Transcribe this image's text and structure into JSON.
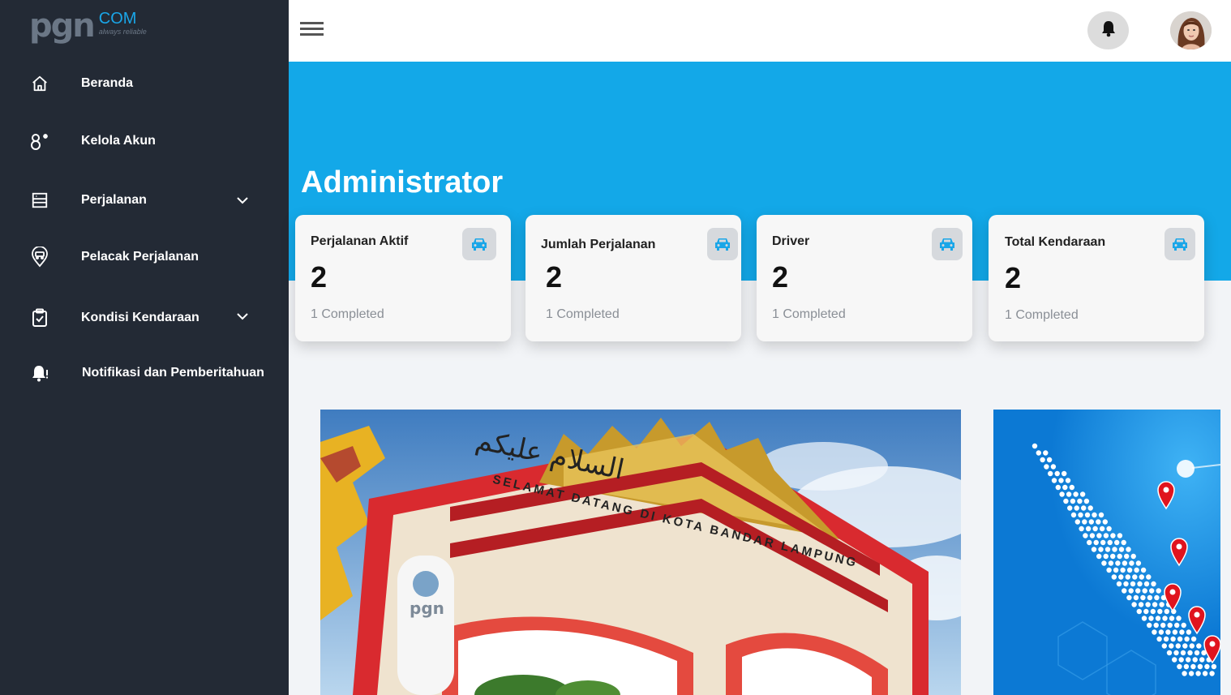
{
  "logo": {
    "brand": "pgn",
    "suffix": "COM",
    "tagline": "always reliable"
  },
  "sidebar": {
    "items": [
      {
        "label": "Beranda",
        "icon": "home-icon"
      },
      {
        "label": "Kelola Akun",
        "icon": "user-settings-icon"
      },
      {
        "label": "Perjalanan",
        "icon": "trip-list-icon",
        "expandable": true
      },
      {
        "label": "Pelacak Perjalanan",
        "icon": "tracker-pin-icon"
      },
      {
        "label": "Kondisi Kendaraan",
        "icon": "clipboard-check-icon",
        "expandable": true
      },
      {
        "label": "Notifikasi dan Pemberitahuan",
        "icon": "bell-alert-icon"
      }
    ]
  },
  "header": {
    "menu_icon": "hamburger-icon",
    "notification_icon": "bell-icon",
    "avatar": "user-avatar"
  },
  "hero": {
    "title": "Administrator"
  },
  "cards": [
    {
      "title": "Perjalanan Aktif",
      "value": "2",
      "sub": "1 Completed",
      "icon": "car-icon"
    },
    {
      "title": "Jumlah Perjalanan",
      "value": "2",
      "sub": "1 Completed",
      "icon": "car-icon"
    },
    {
      "title": "Driver",
      "value": "2",
      "sub": "1 Completed",
      "icon": "car-icon"
    },
    {
      "title": "Total Kendaraan",
      "value": "2",
      "sub": "1 Completed",
      "icon": "car-icon"
    }
  ],
  "banner": {
    "arch_arabic": "السلام عليكم",
    "arch_text": "SELAMAT DATANG DI KOTA BANDAR LAMPUNG",
    "arch_logo": "pgn"
  },
  "colors": {
    "sidebar": "#232a35",
    "accent": "#13a8e8",
    "logo_com": "#1aa6e8",
    "pin": "#e0141e"
  }
}
